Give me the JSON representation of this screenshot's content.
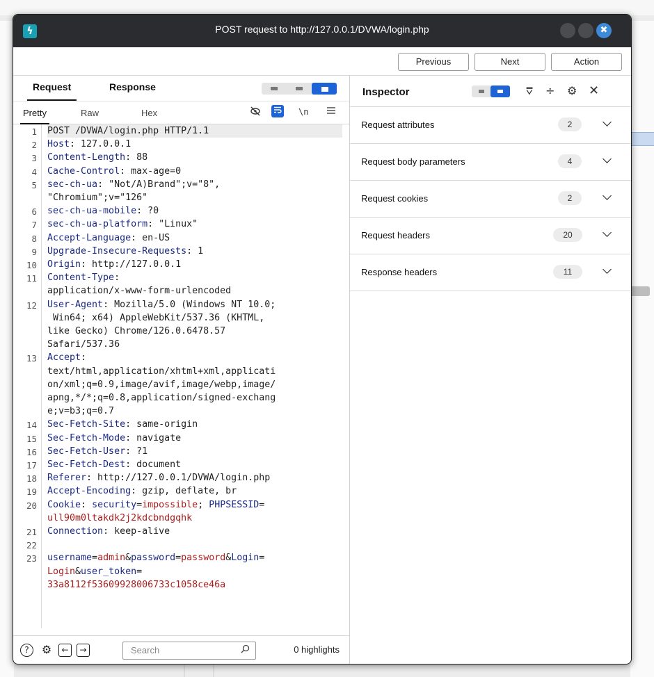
{
  "window": {
    "title": "POST request to http://127.0.0.1/DVWA/login.php",
    "app_icon": "ϟ",
    "close_glyph": "✖"
  },
  "nav": {
    "previous": "Previous",
    "next": "Next",
    "action": "Action"
  },
  "editor": {
    "tabs": [
      "Request",
      "Response"
    ],
    "subtabs": [
      "Pretty",
      "Raw",
      "Hex"
    ],
    "newline_label": "\\n",
    "lines": [
      {
        "n": "1",
        "segments": [
          {
            "t": "POST /DVWA/login.php HTTP/1.1",
            "c": "hv"
          }
        ],
        "first": true
      },
      {
        "n": "2",
        "segments": [
          {
            "t": "Host",
            "c": "hk"
          },
          {
            "t": ": 127.0.0.1",
            "c": "hv"
          }
        ]
      },
      {
        "n": "3",
        "segments": [
          {
            "t": "Content-Length",
            "c": "hk"
          },
          {
            "t": ": 88",
            "c": "hv"
          }
        ]
      },
      {
        "n": "4",
        "segments": [
          {
            "t": "Cache-Control",
            "c": "hk"
          },
          {
            "t": ": max-age=0",
            "c": "hv"
          }
        ]
      },
      {
        "n": "5",
        "segments": [
          {
            "t": "sec-ch-ua",
            "c": "hk"
          },
          {
            "t": ": \"Not/A)Brand\";v=\"8\",",
            "c": "hv"
          }
        ]
      },
      {
        "n": "",
        "segments": [
          {
            "t": "\"Chromium\";v=\"126\"",
            "c": "hv"
          }
        ]
      },
      {
        "n": "6",
        "segments": [
          {
            "t": "sec-ch-ua-mobile",
            "c": "hk"
          },
          {
            "t": ": ?0",
            "c": "hv"
          }
        ]
      },
      {
        "n": "7",
        "segments": [
          {
            "t": "sec-ch-ua-platform",
            "c": "hk"
          },
          {
            "t": ": \"Linux\"",
            "c": "hv"
          }
        ]
      },
      {
        "n": "8",
        "segments": [
          {
            "t": "Accept-Language",
            "c": "hk"
          },
          {
            "t": ": en-US",
            "c": "hv"
          }
        ]
      },
      {
        "n": "9",
        "segments": [
          {
            "t": "Upgrade-Insecure-Requests",
            "c": "hk"
          },
          {
            "t": ": 1",
            "c": "hv"
          }
        ]
      },
      {
        "n": "10",
        "segments": [
          {
            "t": "Origin",
            "c": "hk"
          },
          {
            "t": ": http://127.0.0.1",
            "c": "hv"
          }
        ]
      },
      {
        "n": "11",
        "segments": [
          {
            "t": "Content-Type",
            "c": "hk"
          },
          {
            "t": ":",
            "c": "hv"
          }
        ]
      },
      {
        "n": "",
        "segments": [
          {
            "t": "application/x-www-form-urlencoded",
            "c": "hv"
          }
        ]
      },
      {
        "n": "12",
        "segments": [
          {
            "t": "User-Agent",
            "c": "hk"
          },
          {
            "t": ": Mozilla/5.0 (Windows NT 10.0;",
            "c": "hv"
          }
        ]
      },
      {
        "n": "",
        "segments": [
          {
            "t": " Win64; x64) AppleWebKit/537.36 (KHTML,",
            "c": "hv"
          }
        ]
      },
      {
        "n": "",
        "segments": [
          {
            "t": "like Gecko) Chrome/126.0.6478.57",
            "c": "hv"
          }
        ]
      },
      {
        "n": "",
        "segments": [
          {
            "t": "Safari/537.36",
            "c": "hv"
          }
        ]
      },
      {
        "n": "13",
        "segments": [
          {
            "t": "Accept",
            "c": "hk"
          },
          {
            "t": ":",
            "c": "hv"
          }
        ]
      },
      {
        "n": "",
        "segments": [
          {
            "t": "text/html,application/xhtml+xml,applicati",
            "c": "hv"
          }
        ]
      },
      {
        "n": "",
        "segments": [
          {
            "t": "on/xml;q=0.9,image/avif,image/webp,image/",
            "c": "hv"
          }
        ]
      },
      {
        "n": "",
        "segments": [
          {
            "t": "apng,*/*;q=0.8,application/signed-exchang",
            "c": "hv"
          }
        ]
      },
      {
        "n": "",
        "segments": [
          {
            "t": "e;v=b3;q=0.7",
            "c": "hv"
          }
        ]
      },
      {
        "n": "14",
        "segments": [
          {
            "t": "Sec-Fetch-Site",
            "c": "hk"
          },
          {
            "t": ": same-origin",
            "c": "hv"
          }
        ]
      },
      {
        "n": "15",
        "segments": [
          {
            "t": "Sec-Fetch-Mode",
            "c": "hk"
          },
          {
            "t": ": navigate",
            "c": "hv"
          }
        ]
      },
      {
        "n": "16",
        "segments": [
          {
            "t": "Sec-Fetch-User",
            "c": "hk"
          },
          {
            "t": ": ?1",
            "c": "hv"
          }
        ]
      },
      {
        "n": "17",
        "segments": [
          {
            "t": "Sec-Fetch-Dest",
            "c": "hk"
          },
          {
            "t": ": document",
            "c": "hv"
          }
        ]
      },
      {
        "n": "18",
        "segments": [
          {
            "t": "Referer",
            "c": "hk"
          },
          {
            "t": ": http://127.0.0.1/DVWA/login.php",
            "c": "hv"
          }
        ]
      },
      {
        "n": "19",
        "segments": [
          {
            "t": "Accept-Encoding",
            "c": "hk"
          },
          {
            "t": ": gzip, deflate, br",
            "c": "hv"
          }
        ]
      },
      {
        "n": "20",
        "segments": [
          {
            "t": "Cookie",
            "c": "hk"
          },
          {
            "t": ": ",
            "c": "hv"
          },
          {
            "t": "security",
            "c": "ck"
          },
          {
            "t": "=",
            "c": "hv"
          },
          {
            "t": "impossible",
            "c": "cv"
          },
          {
            "t": "; ",
            "c": "hv"
          },
          {
            "t": "PHPSESSID",
            "c": "ck"
          },
          {
            "t": "=",
            "c": "hv"
          }
        ]
      },
      {
        "n": "",
        "segments": [
          {
            "t": "ull90m0ltakdk2j2kdcbndgqhk",
            "c": "cv"
          }
        ]
      },
      {
        "n": "21",
        "segments": [
          {
            "t": "Connection",
            "c": "hk"
          },
          {
            "t": ": keep-alive",
            "c": "hv"
          }
        ]
      },
      {
        "n": "22",
        "segments": []
      },
      {
        "n": "23",
        "segments": [
          {
            "t": "username",
            "c": "ck"
          },
          {
            "t": "=",
            "c": "hv"
          },
          {
            "t": "admin",
            "c": "cv"
          },
          {
            "t": "&",
            "c": "hv"
          },
          {
            "t": "password",
            "c": "ck"
          },
          {
            "t": "=",
            "c": "hv"
          },
          {
            "t": "password",
            "c": "cv"
          },
          {
            "t": "&",
            "c": "hv"
          },
          {
            "t": "Login",
            "c": "ck"
          },
          {
            "t": "=",
            "c": "hv"
          }
        ]
      },
      {
        "n": "",
        "segments": [
          {
            "t": "Login",
            "c": "cv"
          },
          {
            "t": "&",
            "c": "hv"
          },
          {
            "t": "user_token",
            "c": "ck"
          },
          {
            "t": "=",
            "c": "hv"
          }
        ]
      },
      {
        "n": "",
        "segments": [
          {
            "t": "33a8112f53609928006733c1058ce46a",
            "c": "cv"
          }
        ]
      }
    ]
  },
  "bottom": {
    "help_glyph": "?",
    "gear_glyph": "⚙",
    "back_glyph": "←",
    "fwd_glyph": "→",
    "search_placeholder": "Search",
    "search_glyph": "⌕",
    "highlights": "0 highlights"
  },
  "inspector": {
    "title": "Inspector",
    "collapse_glyph": "⩢",
    "expand_glyph": "÷",
    "gear_glyph": "⚙",
    "close_glyph": "✕",
    "sections": [
      {
        "label": "Request attributes",
        "count": "2"
      },
      {
        "label": "Request body parameters",
        "count": "4"
      },
      {
        "label": "Request cookies",
        "count": "2"
      },
      {
        "label": "Request headers",
        "count": "20"
      },
      {
        "label": "Response headers",
        "count": "11"
      }
    ]
  },
  "colors": {
    "accent": "#1e63d6",
    "header_key": "#1b2a86",
    "value_red": "#b01c1c",
    "titlebar": "#2a2c2f"
  }
}
